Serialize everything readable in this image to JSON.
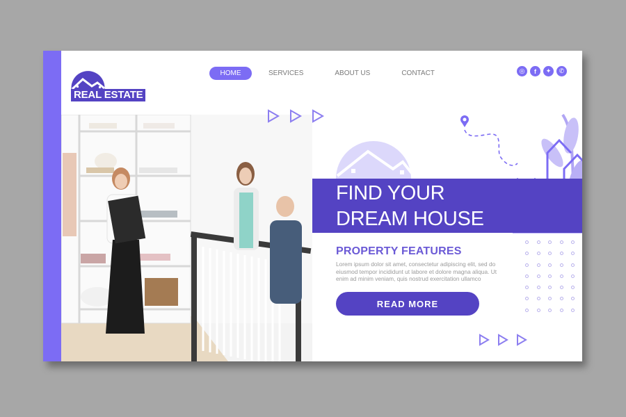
{
  "brand": {
    "name": "REAL ESTATE",
    "accent": "#7c6cf4",
    "primary": "#5443c3"
  },
  "nav": {
    "items": [
      {
        "label": "HOME",
        "active": true
      },
      {
        "label": "SERVICES",
        "active": false
      },
      {
        "label": "ABOUT US",
        "active": false
      },
      {
        "label": "CONTACT",
        "active": false
      }
    ]
  },
  "social": [
    {
      "icon": "instagram-icon",
      "glyph": "◎"
    },
    {
      "icon": "facebook-icon",
      "glyph": "f"
    },
    {
      "icon": "twitter-icon",
      "glyph": "✦"
    },
    {
      "icon": "whatsapp-icon",
      "glyph": "✆"
    }
  ],
  "hero": {
    "title_line1": "FIND YOUR",
    "title_line2": "DREAM HOUSE"
  },
  "features": {
    "title": "PROPERTY FEATURES",
    "text": "Lorem ipsum dolor sit amet, consectetur adipiscing elit, sed do eiusmod tempor incididunt ut labore et dolore magna aliqua. Ut enim ad minim veniam, quis nostrud exercitation ullamco",
    "button_label": "READ MORE"
  },
  "photo": {
    "alt": "Real estate agent showing a bright white room with wardrobe shelves to a couple on a staircase"
  }
}
